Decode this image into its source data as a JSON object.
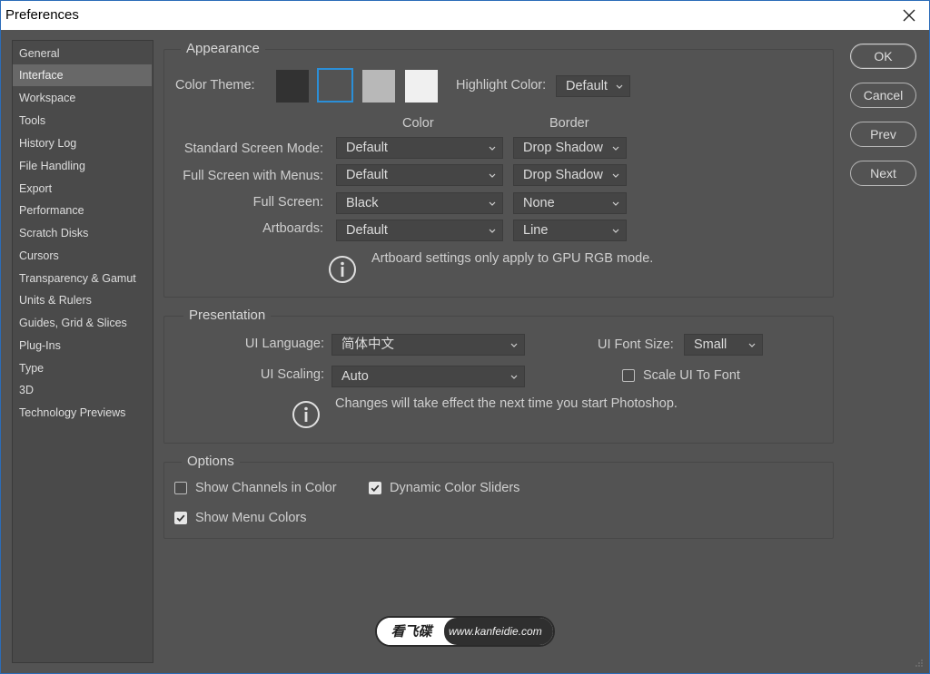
{
  "window": {
    "title": "Preferences"
  },
  "sidebar": {
    "items": [
      {
        "label": "General"
      },
      {
        "label": "Interface"
      },
      {
        "label": "Workspace"
      },
      {
        "label": "Tools"
      },
      {
        "label": "History Log"
      },
      {
        "label": "File Handling"
      },
      {
        "label": "Export"
      },
      {
        "label": "Performance"
      },
      {
        "label": "Scratch Disks"
      },
      {
        "label": "Cursors"
      },
      {
        "label": "Transparency & Gamut"
      },
      {
        "label": "Units & Rulers"
      },
      {
        "label": "Guides, Grid & Slices"
      },
      {
        "label": "Plug-Ins"
      },
      {
        "label": "Type"
      },
      {
        "label": "3D"
      },
      {
        "label": "Technology Previews"
      }
    ],
    "selected": "Interface"
  },
  "appearance": {
    "legend": "Appearance",
    "color_theme_label": "Color Theme:",
    "themes": [
      "#323232",
      "#535353",
      "#b8b8b8",
      "#f0f0f0"
    ],
    "selected_theme_index": 1,
    "highlight_label": "Highlight Color:",
    "highlight_value": "Default",
    "col_color": "Color",
    "col_border": "Border",
    "rows": [
      {
        "label": "Standard Screen Mode:",
        "color": "Default",
        "border": "Drop Shadow"
      },
      {
        "label": "Full Screen with Menus:",
        "color": "Default",
        "border": "Drop Shadow"
      },
      {
        "label": "Full Screen:",
        "color": "Black",
        "border": "None"
      },
      {
        "label": "Artboards:",
        "color": "Default",
        "border": "Line"
      }
    ],
    "note": "Artboard settings only apply to GPU RGB mode."
  },
  "presentation": {
    "legend": "Presentation",
    "ui_language_label": "UI Language:",
    "ui_language_value": "简体中文",
    "ui_font_size_label": "UI Font Size:",
    "ui_font_size_value": "Small",
    "ui_scaling_label": "UI Scaling:",
    "ui_scaling_value": "Auto",
    "scale_ui_label": "Scale UI To Font",
    "scale_ui_checked": false,
    "note": "Changes will take effect the next time you start Photoshop."
  },
  "options": {
    "legend": "Options",
    "show_channels_label": "Show Channels in Color",
    "show_channels_checked": false,
    "dynamic_sliders_label": "Dynamic Color Sliders",
    "dynamic_sliders_checked": true,
    "show_menu_colors_label": "Show Menu Colors",
    "show_menu_colors_checked": true
  },
  "buttons": {
    "ok": "OK",
    "cancel": "Cancel",
    "prev": "Prev",
    "next": "Next"
  },
  "watermark": {
    "left": "看飞碟",
    "right": "www.kanfeidie.com"
  },
  "colors": {
    "bg": "#535353",
    "sidebar": "#4a4a4a",
    "selected": "#686868",
    "accent_border": "#2b8fd8"
  }
}
